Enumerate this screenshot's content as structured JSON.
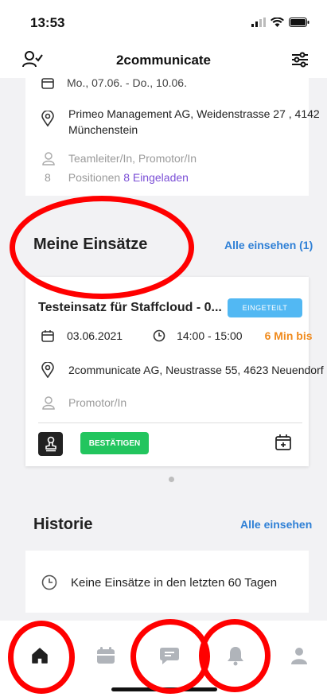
{
  "status": {
    "time": "13:53"
  },
  "nav": {
    "title": "2communicate",
    "left_icon": "user-check-icon",
    "right_icon": "sliders-icon"
  },
  "top_card": {
    "date_text": "Mo., 07.06. - Do., 10.06.",
    "location_line1": "Primeo Management AG, Weidenstrasse 27 , 4142",
    "location_line2": "Münchenstein",
    "roles": "Teamleiter/In, Promotor/In",
    "positions_count": "8",
    "positions_label": "Positionen",
    "invited": "8 Eingeladen"
  },
  "my_assignments": {
    "title": "Meine Einsätze",
    "see_all": "Alle einsehen (1)",
    "card": {
      "title": "Testeinsatz für Staffcloud - 0...",
      "status_badge": "EINGETEILT",
      "date": "03.06.2021",
      "time": "14:00 - 15:00",
      "countdown": "6 Min bis",
      "location": "2communicate AG, Neustrasse 55, 4623 Neuendorf",
      "role": "Promotor/In",
      "confirm_label": "BESTÄTIGEN"
    }
  },
  "history": {
    "title": "Historie",
    "see_all": "Alle einsehen",
    "empty_text": "Keine Einsätze in den letzten 60 Tagen"
  },
  "tabbar": {
    "items": [
      "home-icon",
      "calendar-icon",
      "chat-icon",
      "bell-icon",
      "profile-icon"
    ]
  },
  "colors": {
    "accent_blue": "#2f80d6",
    "badge_blue": "#52b8f3",
    "confirm_green": "#22c55e",
    "countdown_orange": "#f08a1c",
    "annotation_red": "#ff0000"
  }
}
